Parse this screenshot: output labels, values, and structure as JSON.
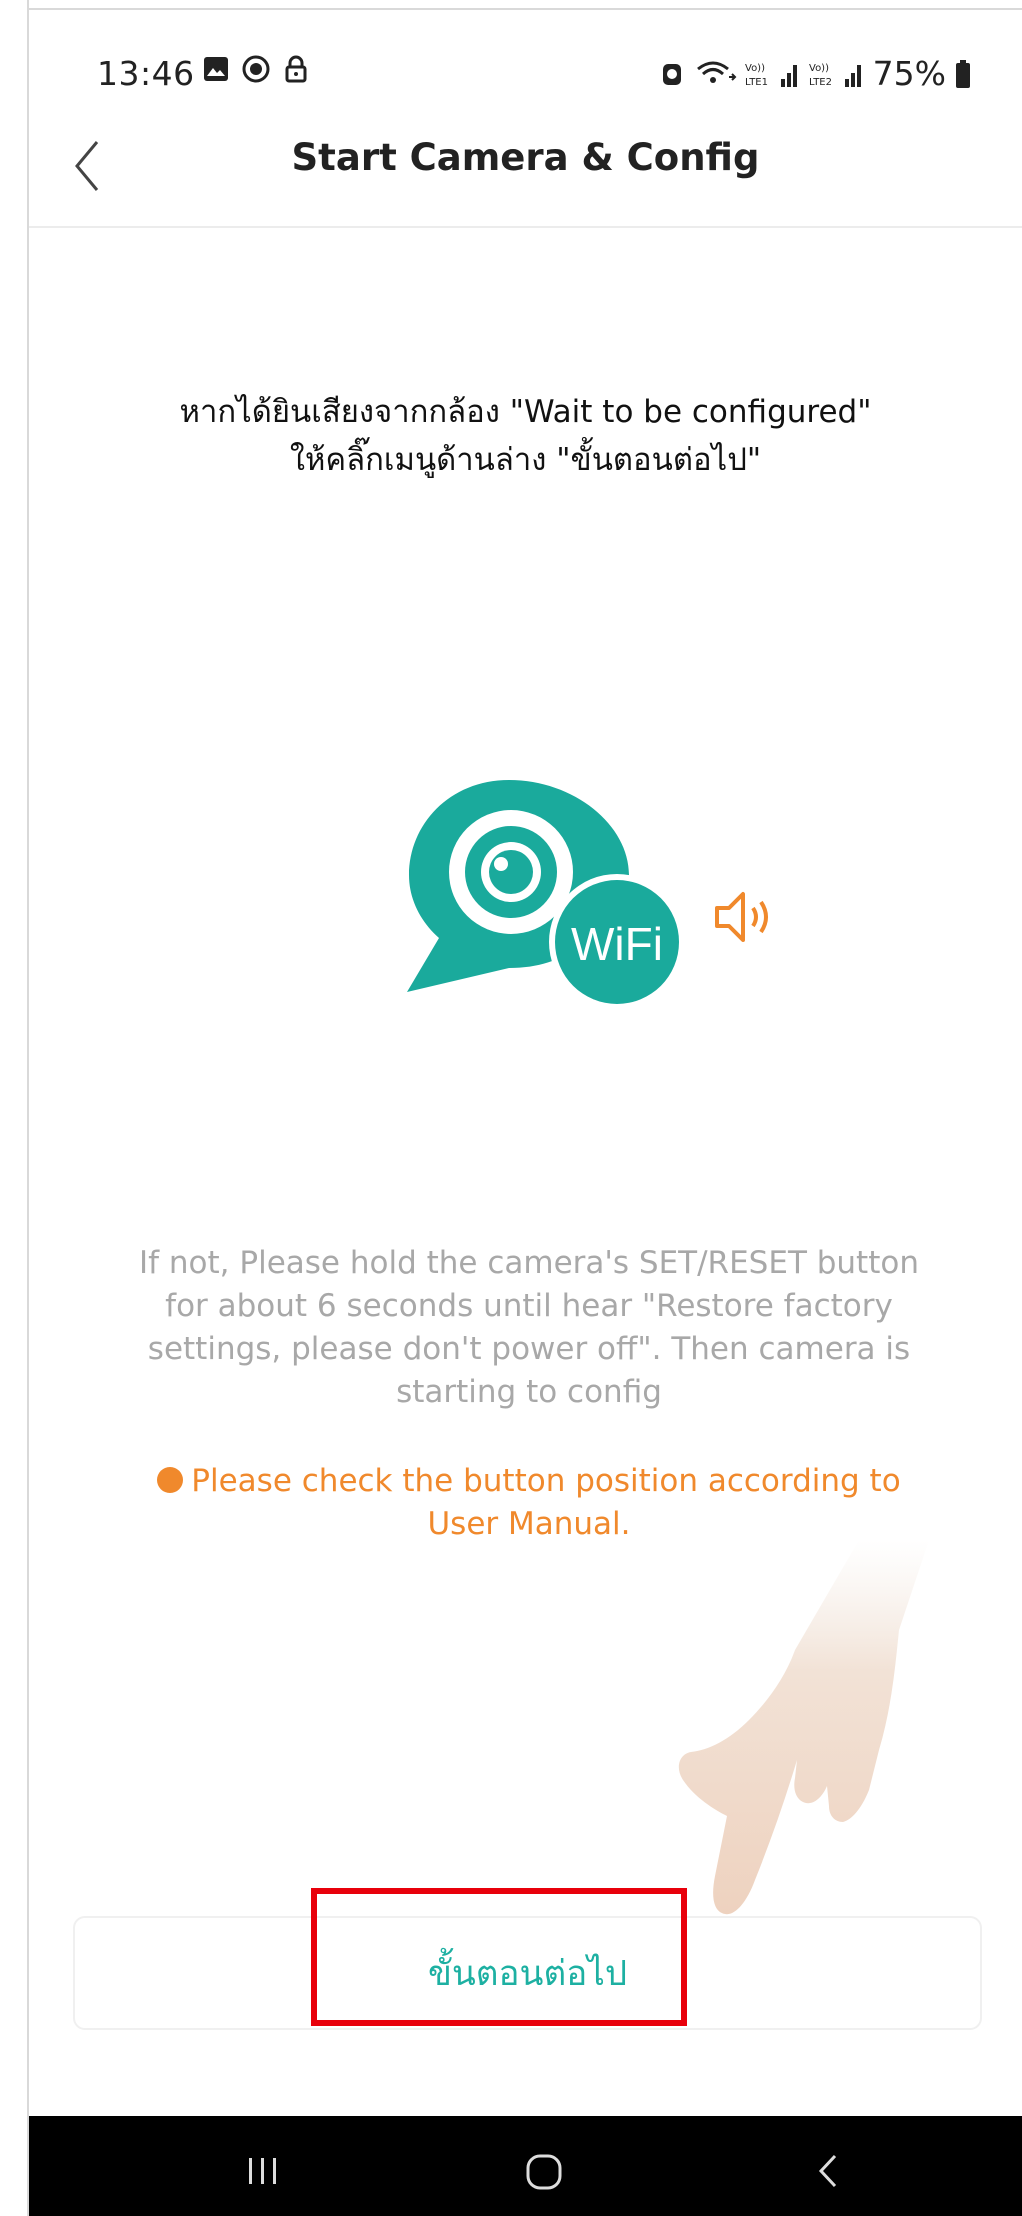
{
  "status_bar": {
    "time": "13:46",
    "battery_text": "75%",
    "left_icons": [
      "gallery-icon",
      "record-icon",
      "lock-icon"
    ],
    "right_icons": [
      "alarm-icon",
      "wifi-icon",
      "signal-sim1-icon",
      "signal-sim2-icon",
      "battery-icon"
    ],
    "sim1_label": "Vo)) LTE1",
    "sim2_label": "Vo)) LTE2"
  },
  "header": {
    "title": "Start Camera & Config",
    "back_icon": "chevron-left-icon"
  },
  "instruction": {
    "line1": "หากได้ยินเสียงจากกล้อง \"Wait to be configured\"",
    "line2": "ให้คลิ๊กเมนูด้านล่าง  \"ขั้นตอนต่อไป\""
  },
  "illustration": {
    "badge_text": "WiFi",
    "icon": "camera-wifi-icon",
    "speaker_icon": "speaker-icon",
    "brand_color": "#1aaa9c",
    "speaker_color": "#f0892c"
  },
  "help": {
    "text": "If not, Please hold the camera's SET/RESET button for about 6 seconds until hear \"Restore factory settings, please don't power off\". Then camera is starting to config"
  },
  "warning": {
    "text": "Please check the button position according to User Manual.",
    "color": "#f0892c"
  },
  "next_button": {
    "label": "ขั้นตอนต่อไป",
    "color": "#1db0a2",
    "highlight_color": "#e8000b"
  },
  "nav_bar": {
    "icons": [
      "recent-apps-icon",
      "home-icon",
      "back-icon"
    ]
  }
}
